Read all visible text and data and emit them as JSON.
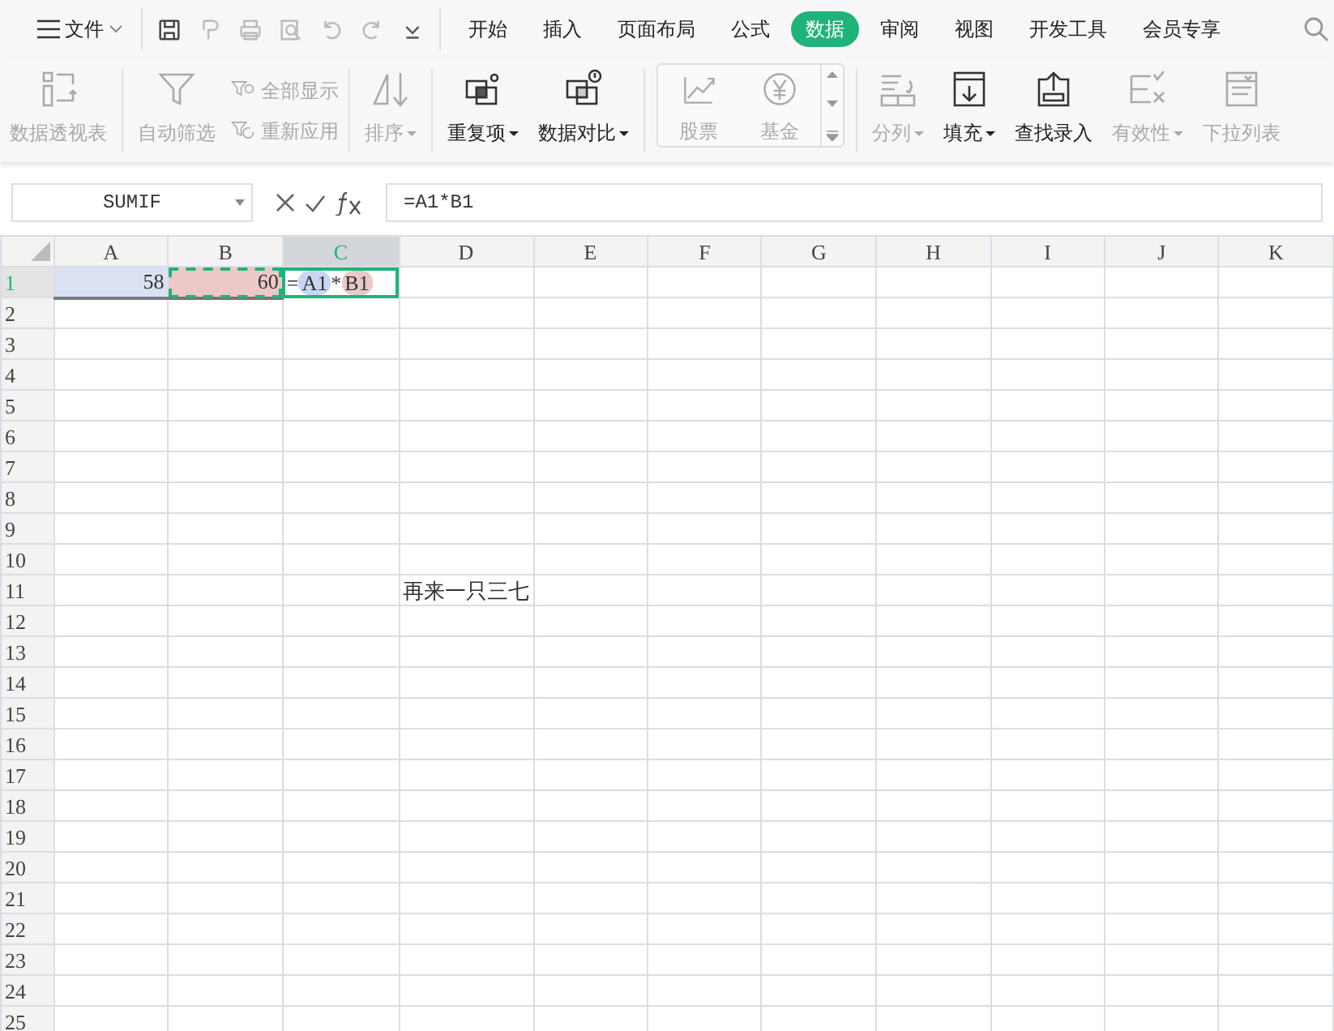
{
  "menu": {
    "file_label": "文件"
  },
  "tabs": [
    {
      "label": "开始",
      "selected": false
    },
    {
      "label": "插入",
      "selected": false
    },
    {
      "label": "页面布局",
      "selected": false
    },
    {
      "label": "公式",
      "selected": false
    },
    {
      "label": "数据",
      "selected": true
    },
    {
      "label": "审阅",
      "selected": false
    },
    {
      "label": "视图",
      "selected": false
    },
    {
      "label": "开发工具",
      "selected": false
    },
    {
      "label": "会员专享",
      "selected": false
    }
  ],
  "ribbon": [
    {
      "kind": "large",
      "label": "数据透视表",
      "disabled": true,
      "dropdown": false
    },
    {
      "kind": "large",
      "label": "自动筛选",
      "disabled": true,
      "dropdown": false
    },
    {
      "kind": "pair",
      "items": [
        {
          "label": "全部显示",
          "disabled": true
        },
        {
          "label": "重新应用",
          "disabled": true
        }
      ]
    },
    {
      "kind": "large",
      "label": "排序",
      "disabled": true,
      "dropdown": true
    },
    {
      "kind": "large",
      "label": "重复项",
      "disabled": false,
      "dropdown": true
    },
    {
      "kind": "large",
      "label": "数据对比",
      "disabled": false,
      "dropdown": true
    },
    {
      "kind": "gallery",
      "items": [
        {
          "label": "股票"
        },
        {
          "label": "基金"
        }
      ]
    },
    {
      "kind": "large",
      "label": "分列",
      "disabled": true,
      "dropdown": true
    },
    {
      "kind": "large",
      "label": "填充",
      "disabled": false,
      "dropdown": true
    },
    {
      "kind": "large",
      "label": "查找录入",
      "disabled": false,
      "dropdown": false
    },
    {
      "kind": "large",
      "label": "有效性",
      "disabled": true,
      "dropdown": true
    },
    {
      "kind": "large",
      "label": "下拉列表",
      "disabled": true,
      "dropdown": false
    }
  ],
  "name_box": "SUMIF",
  "formula": "=A1*B1",
  "columns": [
    {
      "label": "A",
      "selected": false
    },
    {
      "label": "B",
      "selected": false
    },
    {
      "label": "C",
      "selected": true
    },
    {
      "label": "D",
      "selected": false
    },
    {
      "label": "E",
      "selected": false
    },
    {
      "label": "F",
      "selected": false
    },
    {
      "label": "G",
      "selected": false
    },
    {
      "label": "H",
      "selected": false
    },
    {
      "label": "I",
      "selected": false
    },
    {
      "label": "J",
      "selected": false
    },
    {
      "label": "K",
      "selected": false
    }
  ],
  "rows": [
    {
      "label": "1",
      "selected": true,
      "cells": [
        {
          "kind": "ref",
          "value": "58",
          "color": "#dae1f3",
          "copied": false
        },
        {
          "kind": "ref",
          "value": "60",
          "color": "#ecc8c8",
          "copied": true
        },
        {
          "kind": "formula",
          "active": true,
          "parts": [
            {
              "text": "="
            },
            {
              "text": "A1",
              "color": "#c9d6f2"
            },
            {
              "text": "*"
            },
            {
              "text": "B1",
              "color": "#ecc8c8"
            }
          ]
        }
      ]
    },
    {
      "label": "2",
      "selected": false
    },
    {
      "label": "3",
      "selected": false
    },
    {
      "label": "4",
      "selected": false
    },
    {
      "label": "5",
      "selected": false
    },
    {
      "label": "6",
      "selected": false
    },
    {
      "label": "7",
      "selected": false
    },
    {
      "label": "8",
      "selected": false
    },
    {
      "label": "9",
      "selected": false
    },
    {
      "label": "10",
      "selected": false
    },
    {
      "label": "11",
      "selected": false,
      "cells": [
        null,
        null,
        null,
        {
          "kind": "text",
          "value": "再来一只三七"
        }
      ]
    },
    {
      "label": "12",
      "selected": false
    },
    {
      "label": "13",
      "selected": false
    },
    {
      "label": "14",
      "selected": false
    },
    {
      "label": "15",
      "selected": false
    },
    {
      "label": "16",
      "selected": false
    },
    {
      "label": "17",
      "selected": false
    },
    {
      "label": "18",
      "selected": false
    },
    {
      "label": "19",
      "selected": false
    },
    {
      "label": "20",
      "selected": false
    },
    {
      "label": "21",
      "selected": false
    },
    {
      "label": "22",
      "selected": false
    },
    {
      "label": "23",
      "selected": false
    },
    {
      "label": "24",
      "selected": false
    },
    {
      "label": "25",
      "selected": false
    }
  ]
}
